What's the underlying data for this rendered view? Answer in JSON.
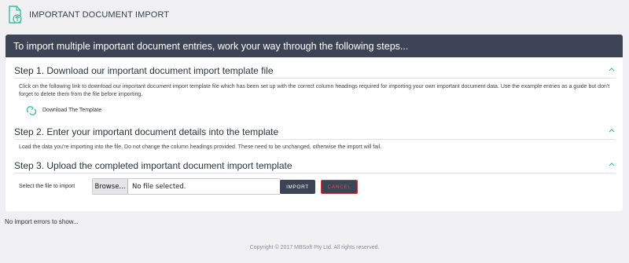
{
  "header": {
    "title": "IMPORTANT DOCUMENT IMPORT",
    "icon": "document-upload-icon"
  },
  "banner": {
    "text": "To import multiple important document entries, work your way through the following steps..."
  },
  "steps": [
    {
      "title": "Step 1. Download our important document import template file",
      "text": "Click on the following link to download our important document import template file which has been set up with the correct column headings required for importing your own important document data.  Use the example entries as a guide but don't forget to delete them from the file before importing.",
      "link_label": "Download The Template"
    },
    {
      "title": "Step 2. Enter your important document details into the template",
      "text": "Load the data you're importing into the file. Do not change the column headings provided. These need to be unchanged, otherwise the import will fail."
    },
    {
      "title": "Step 3. Upload the completed important document import template",
      "file_label": "Select the file to import",
      "browse_label": "Browse...",
      "file_status": "No file selected.",
      "import_label": "IMPORT",
      "cancel_label": "CANCEL"
    }
  ],
  "status": {
    "errors_text": "No import errors to show..."
  },
  "footer": {
    "text": "Copyright © 2017 MBSoft Pty Ltd. All rights reserved."
  },
  "colors": {
    "banner": "#3c4455",
    "accent": "#3bbfa0",
    "cancel_text": "#e34a4a"
  }
}
